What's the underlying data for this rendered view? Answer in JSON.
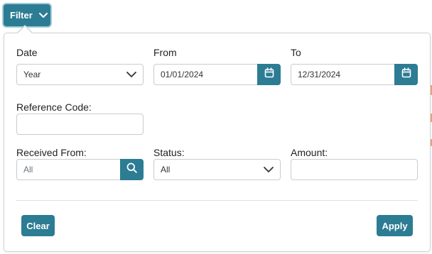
{
  "filter_toggle": {
    "label": "Filter",
    "icon": "chevron-down-icon"
  },
  "date": {
    "label": "Date",
    "selected": "Year"
  },
  "from": {
    "label": "From",
    "value": "01/01/2024",
    "icon": "calendar-icon"
  },
  "to": {
    "label": "To",
    "value": "12/31/2024",
    "icon": "calendar-icon"
  },
  "reference_code": {
    "label": "Reference Code:",
    "value": ""
  },
  "received_from": {
    "label": "Received From:",
    "placeholder": "All",
    "icon": "search-icon"
  },
  "status": {
    "label": "Status:",
    "selected": "All"
  },
  "amount": {
    "label": "Amount:",
    "value": ""
  },
  "actions": {
    "clear_label": "Clear",
    "apply_label": "Apply"
  },
  "colors": {
    "accent": "#2c7c93",
    "border": "#c8ccd0",
    "text": "#222222"
  }
}
